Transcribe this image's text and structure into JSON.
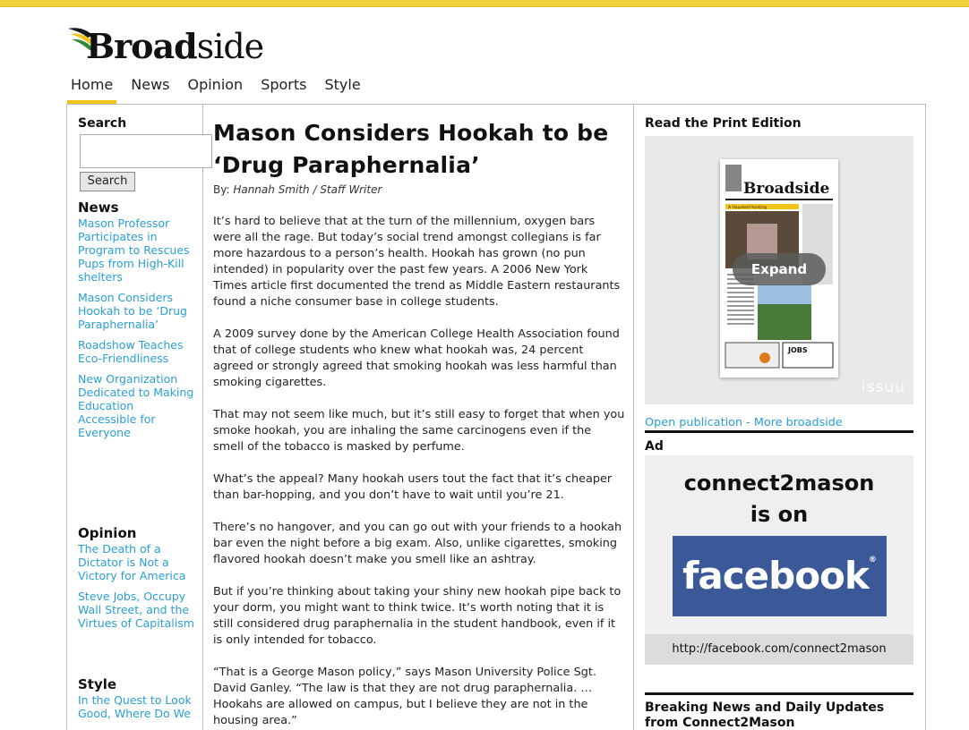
{
  "brand": {
    "name_bold": "Broad",
    "name_light": "side",
    "accent_color": "#f0c419",
    "link_color": "#2a9fd6"
  },
  "nav": {
    "items": [
      "Home",
      "News",
      "Opinion",
      "Sports",
      "Style"
    ],
    "active": "Home"
  },
  "sidebar": {
    "search": {
      "heading": "Search",
      "input_value": "",
      "button_label": "Search"
    },
    "sections": [
      {
        "heading": "News",
        "links": [
          "Mason Professor Participates in Program to Rescues Pups from High-Kill shelters",
          "Mason Considers Hookah to be ‘Drug Paraphernalia’",
          "Roadshow Teaches Eco-Friendliness",
          "New Organization Dedicated to Making Education Accessible for Everyone"
        ]
      },
      {
        "heading": "Opinion",
        "links": [
          "The Death of a Dictator is Not a Victory for America",
          "Steve Jobs, Occupy Wall Street, and the Virtues of Capitalism"
        ]
      },
      {
        "heading": "Style",
        "links": [
          "In the Quest to Look Good, Where Do We"
        ]
      }
    ]
  },
  "article": {
    "title": "Mason Considers Hookah to be ‘Drug Paraphernalia’",
    "byline_prefix": "By: ",
    "byline_author": "Hannah Smith / Staff Writer",
    "paragraphs": [
      "It’s hard to believe that at the turn of the millennium, oxygen bars were all the rage. But today’s social trend amongst collegians is far more hazardous to a person’s health. Hookah has grown (no pun intended) in popularity over the past few years. A 2006 New York Times article first documented the trend as Middle Eastern restaurants found a niche consumer base in college students.",
      "A 2009 survey done by the American College Health Association found that of college students who knew what hookah was, 24 percent agreed or strongly agreed that smoking hookah was less harmful than smoking cigarettes.",
      "That may not seem like much, but it’s still easy to forget that when you smoke hookah, you are inhaling the same carcinogens even if the smell of the tobacco is masked by perfume.",
      "What’s the appeal? Many hookah users tout the fact that it’s cheaper than bar-hopping, and you don’t have to wait until you’re 21.",
      "There’s no hangover, and you can go out with your friends to a hookah bar even the night before a big exam. Also, unlike cigarettes, smoking flavored hookah doesn’t make you smell like an ashtray.",
      "But if you’re thinking about taking your shiny new hookah pipe back to your dorm, you might want to think twice. It’s worth noting that it is still considered drug paraphernalia in the student handbook, even if it is only intended for tobacco.",
      "“That is a George Mason policy,” says Mason University Police Sgt. David Ganley. “The law is that they are not drug paraphernalia. … Hookahs are allowed on campus, but I believe they are not in the housing area.”"
    ]
  },
  "right": {
    "print": {
      "heading": "Read the Print Edition",
      "expand_label": "Expand",
      "issuu_label": "issuu",
      "open_link": "Open publication",
      "separator": " - ",
      "more_link": "More broadside",
      "thumb_masthead": "Broadside",
      "thumb_headline": "A Haunted Hunting",
      "thumb_jobs": "JOBS"
    },
    "ad": {
      "heading": "Ad",
      "line1": "connect2mason",
      "line2": "is on",
      "fb_label": "facebook",
      "fb_mark": "®",
      "url": "http://facebook.com/connect2mason",
      "fb_color": "#3b5998"
    },
    "breaking": {
      "heading": "Breaking News and Daily Updates from Connect2Mason"
    }
  }
}
